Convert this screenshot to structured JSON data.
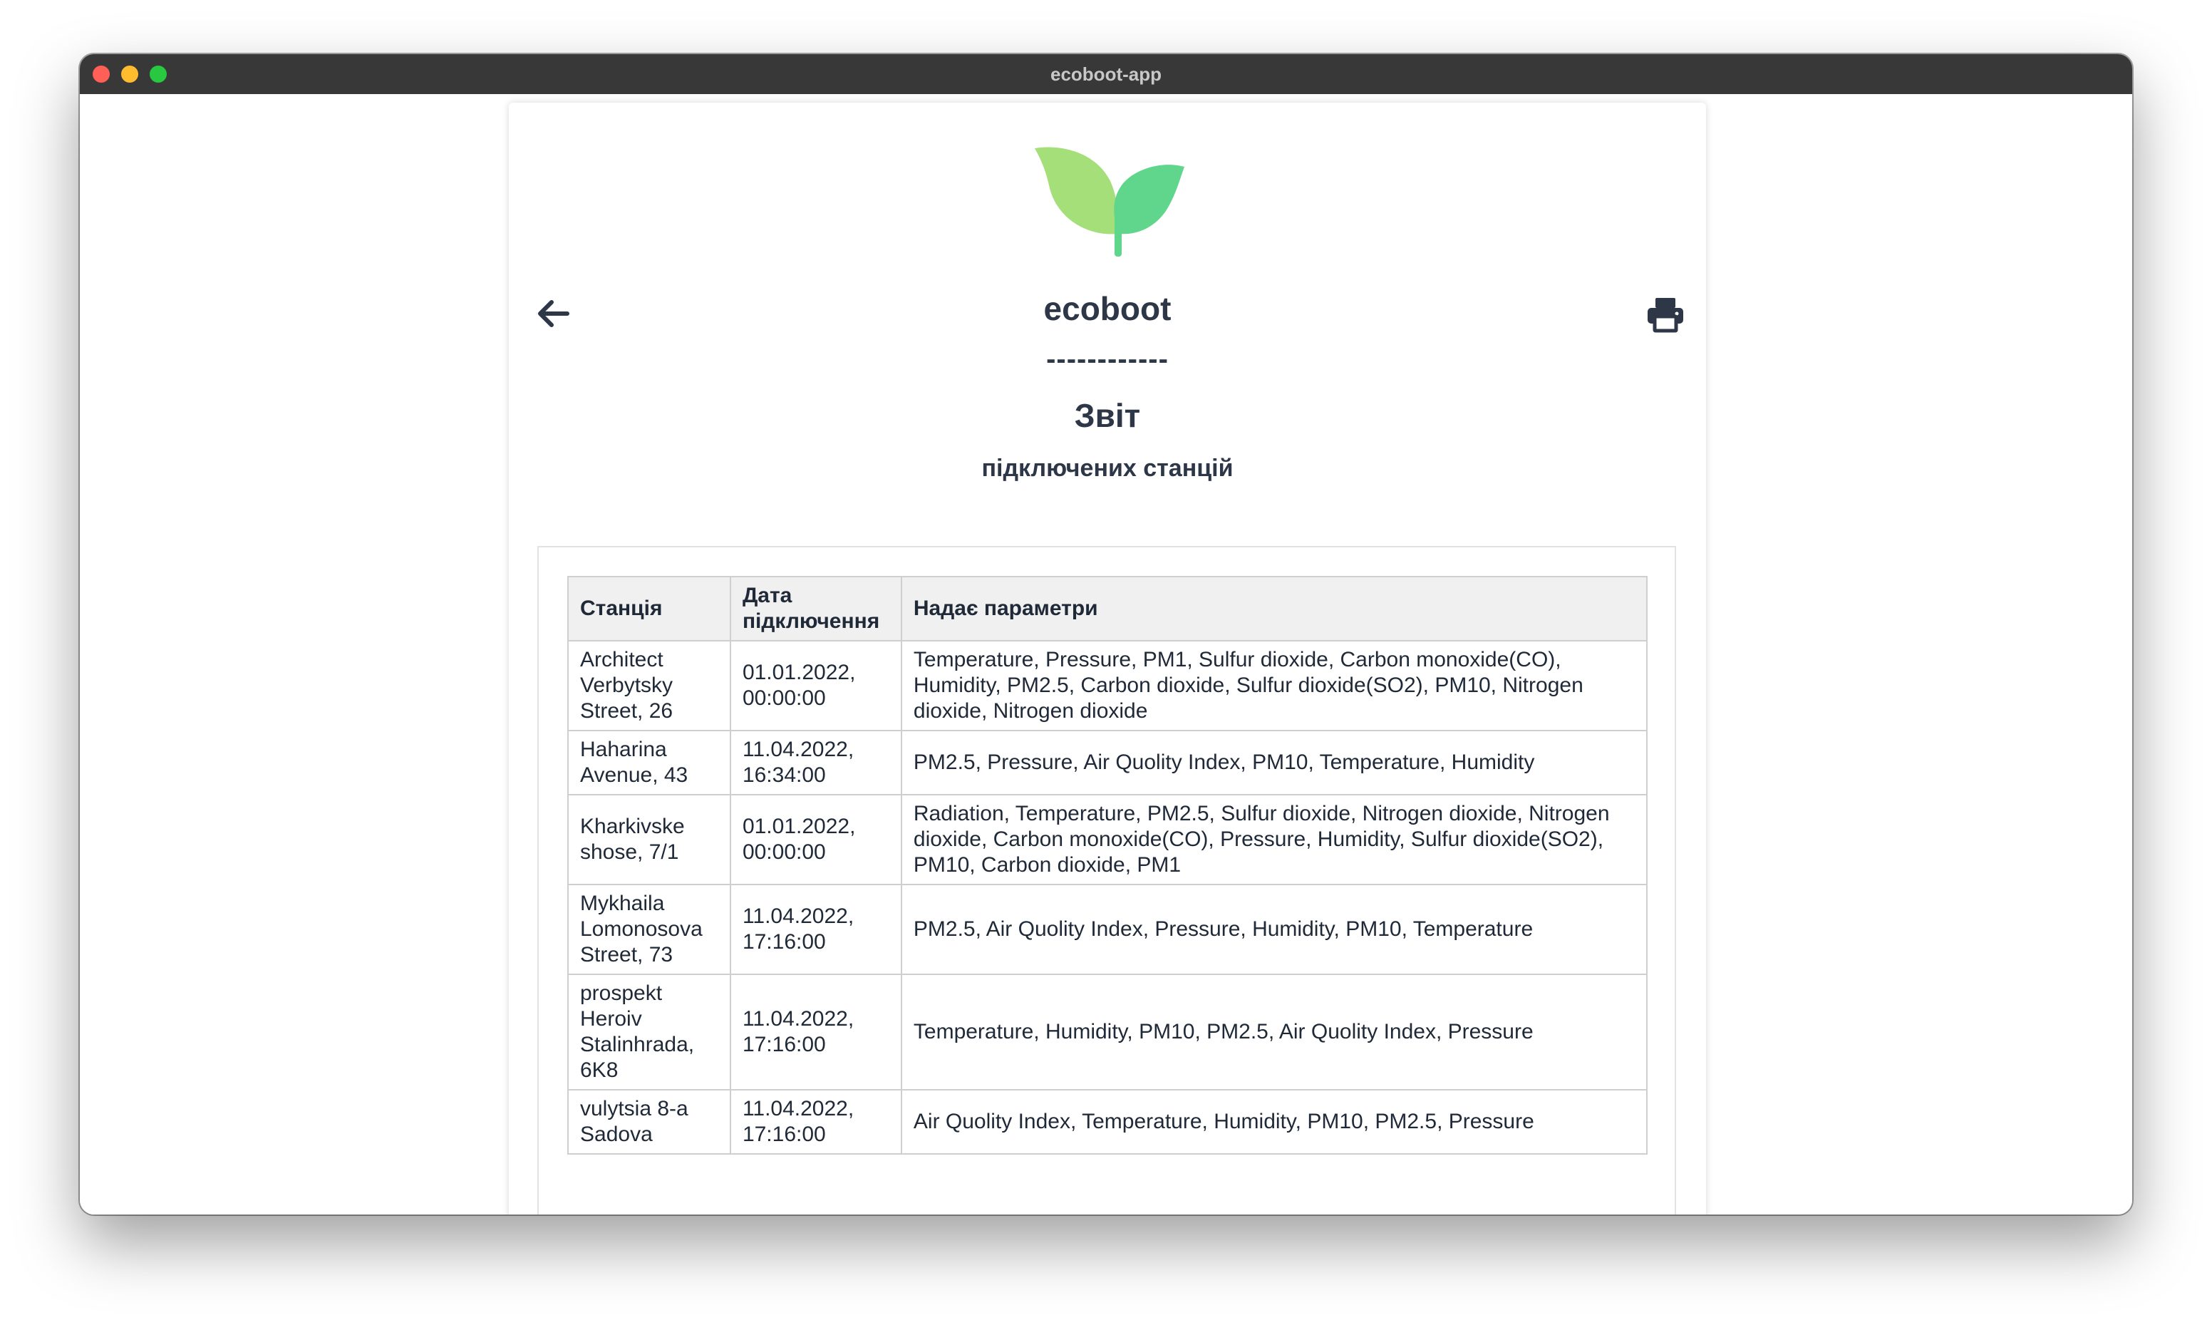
{
  "window": {
    "title": "ecoboot-app"
  },
  "header": {
    "app_name": "ecoboot",
    "divider": "------------",
    "report_title": "Звіт",
    "report_subtitle": "підключених станцій",
    "logo_icon": "leaf-sprout-icon",
    "back_icon": "arrow-left-icon",
    "print_icon": "printer-icon"
  },
  "colors": {
    "leaf_light": "#a4df7a",
    "leaf_dark": "#5fd68c",
    "text": "#2d3748",
    "header_bg": "#f0f0f0"
  },
  "table": {
    "columns": [
      "Станція",
      "Дата підключення",
      "Надає параметри"
    ],
    "rows": [
      {
        "station": "Architect Verbytsky Street, 26",
        "date": "01.01.2022, 00:00:00",
        "params": "Temperature, Pressure, PM1, Sulfur dioxide, Carbon monoxide(CO), Humidity, PM2.5, Carbon dioxide, Sulfur dioxide(SO2), PM10, Nitrogen dioxide, Nitrogen dioxide"
      },
      {
        "station": "Haharina Avenue, 43",
        "date": "11.04.2022, 16:34:00",
        "params": "PM2.5, Pressure, Air Quolity Index, PM10, Temperature, Humidity"
      },
      {
        "station": "Kharkivske shose, 7/1",
        "date": "01.01.2022, 00:00:00",
        "params": "Radiation, Temperature, PM2.5, Sulfur dioxide, Nitrogen dioxide, Nitrogen dioxide, Carbon monoxide(CO), Pressure, Humidity, Sulfur dioxide(SO2), PM10, Carbon dioxide, PM1"
      },
      {
        "station": "Mykhaila Lomonosova Street, 73",
        "date": "11.04.2022, 17:16:00",
        "params": "PM2.5, Air Quolity Index, Pressure, Humidity, PM10, Temperature"
      },
      {
        "station": "prospekt Heroiv Stalinhrada, 6K8",
        "date": "11.04.2022, 17:16:00",
        "params": "Temperature, Humidity, PM10, PM2.5, Air Quolity Index, Pressure"
      },
      {
        "station": "vulytsia 8-a Sadova",
        "date": "11.04.2022, 17:16:00",
        "params": "Air Quolity Index, Temperature, Humidity, PM10, PM2.5, Pressure"
      }
    ]
  }
}
